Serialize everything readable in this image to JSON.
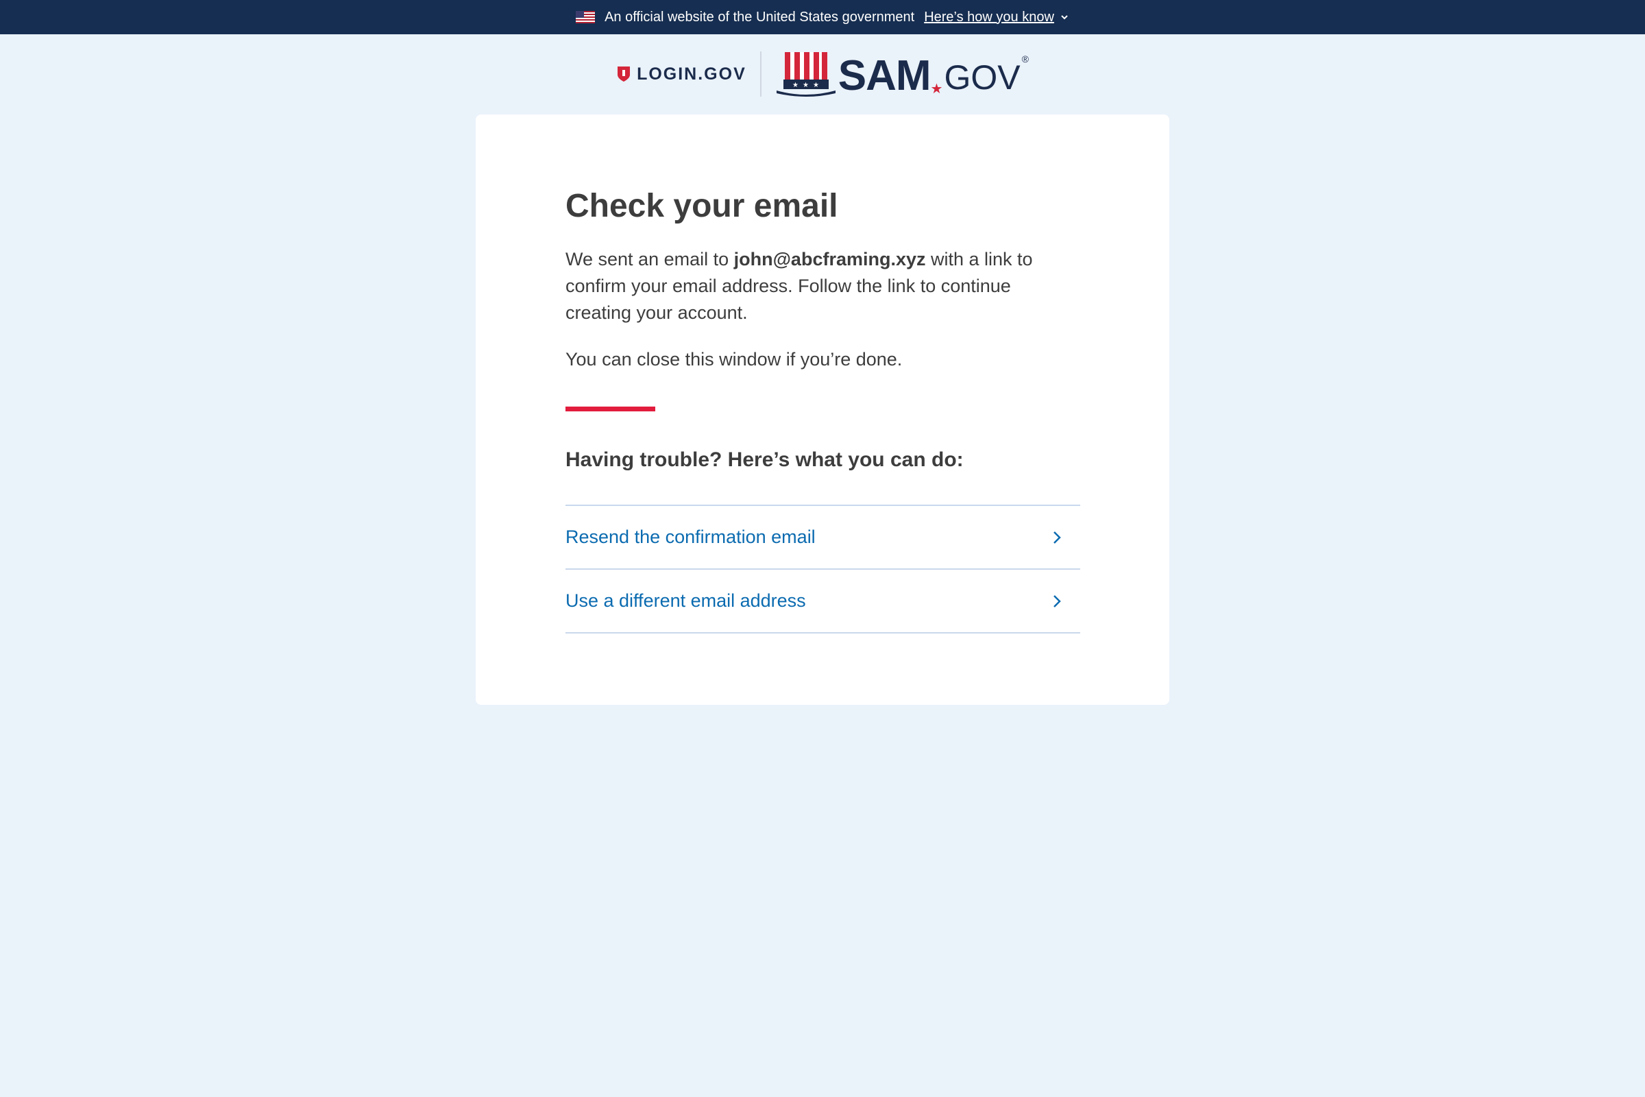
{
  "banner": {
    "official_text": "An official website of the United States government",
    "how_link": "Here’s how you know",
    "flag_icon": "us-flag-icon",
    "chevron_icon": "chevron-down-icon"
  },
  "brand": {
    "login_text": "LOGIN.GOV",
    "sam_text": "SAM",
    "gov_text": "GOV",
    "reg_mark": "®",
    "star": "★"
  },
  "colors": {
    "banner_bg": "#162e51",
    "page_bg": "#eaf2fa",
    "accent_red": "#e21c3d",
    "link_blue": "#0b6bb0"
  },
  "card": {
    "title": "Check your email",
    "message_before": "We sent an email to ",
    "email": "john@abcframing.xyz",
    "message_after": " with a link to confirm your email address. Follow the link to continue creating your account.",
    "close_message": "You can close this window if you’re done.",
    "trouble_heading": "Having trouble? Here’s what you can do:",
    "options": [
      {
        "label": "Resend the confirmation email",
        "icon": "chevron-right-icon"
      },
      {
        "label": "Use a different email address",
        "icon": "chevron-right-icon"
      }
    ]
  }
}
